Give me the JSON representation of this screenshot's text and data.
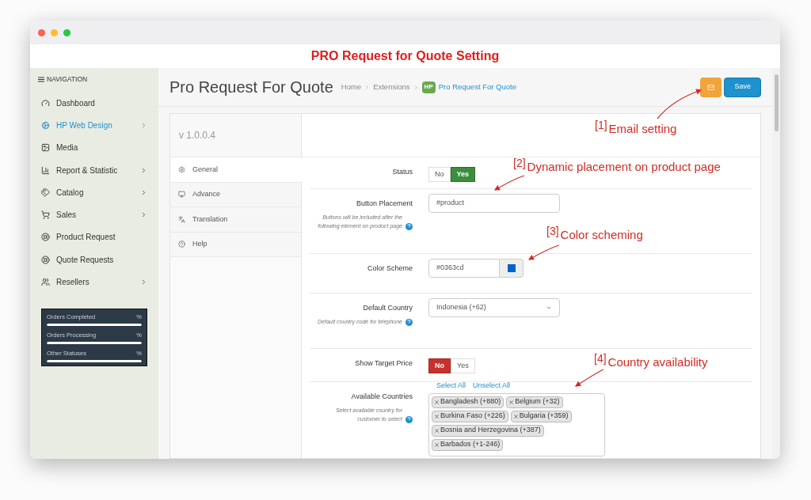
{
  "window": {
    "title": "PRO Request for Quote Setting"
  },
  "sidebar": {
    "heading": "NAVIGATION",
    "items": [
      {
        "label": "Dashboard",
        "selected": false,
        "submenu": false
      },
      {
        "label": "HP Web Design",
        "selected": true,
        "submenu": true
      },
      {
        "label": "Media",
        "selected": false,
        "submenu": false
      },
      {
        "label": "Report & Statistic",
        "selected": false,
        "submenu": true
      },
      {
        "label": "Catalog",
        "selected": false,
        "submenu": true
      },
      {
        "label": "Sales",
        "selected": false,
        "submenu": true
      },
      {
        "label": "Product Request",
        "selected": false,
        "submenu": false
      },
      {
        "label": "Quote Requests",
        "selected": false,
        "submenu": false
      },
      {
        "label": "Resellers",
        "selected": false,
        "submenu": true
      }
    ],
    "stats": [
      {
        "label": "Orders Completed",
        "reading": "%",
        "level": 1
      },
      {
        "label": "Orders Processing",
        "reading": "%",
        "level": 1
      },
      {
        "label": "Other Statuses",
        "reading": "%",
        "level": 1
      }
    ]
  },
  "page": {
    "title": "Pro Request For Quote",
    "breadcrumb": [
      {
        "label": "Home",
        "kind": "link"
      },
      {
        "label": "Extensions",
        "kind": "link"
      },
      {
        "label": "Pro Request For Quote",
        "kind": "current",
        "badge": "HP"
      }
    ],
    "buttons": [
      {
        "kind": "email"
      },
      {
        "kind": "save",
        "label": "Save"
      }
    ]
  },
  "version": "v 1.0.0.4",
  "tabs": [
    {
      "label": "General",
      "selected": true
    },
    {
      "label": "Advance",
      "selected": false
    },
    {
      "label": "Translation",
      "selected": false
    },
    {
      "label": "Help",
      "selected": false
    }
  ],
  "fields": [
    {
      "kind": "toggle",
      "label": "Status",
      "options": [
        {
          "label": "No",
          "selected": false
        },
        {
          "label": "Yes",
          "selected": true
        }
      ]
    },
    {
      "kind": "text",
      "label": "Button Placement",
      "help": "Buttons will be included after the following element on product page",
      "value": "#product"
    },
    {
      "kind": "color",
      "label": "Color Scheme",
      "value": "#0363cd",
      "color": "#0363cd"
    },
    {
      "kind": "select",
      "label": "Default Country",
      "help": "Default country code for telephone",
      "value": "Indonesia (+62)"
    },
    {
      "kind": "toggle",
      "label": "Show Target Price",
      "options": [
        {
          "label": "No",
          "selected": true
        },
        {
          "label": "Yes",
          "selected": false
        }
      ]
    },
    {
      "kind": "tags",
      "label": "Available Countries",
      "help": "Select available country for customer to select",
      "links": [
        "Select All",
        "Unselect All"
      ],
      "tags": [
        "Bangladesh (+880)",
        "Belgium (+32)",
        "Burkina Faso (+226)",
        "Bulgaria (+359)",
        "Bosnia and Herzegovina (+387)",
        "Barbados (+1-246)"
      ]
    }
  ],
  "annotations": [
    {
      "number": "[1]",
      "text": "Email setting"
    },
    {
      "number": "[2]",
      "text": "Dynamic placement on product page"
    },
    {
      "number": "[3]",
      "text": "Color scheming"
    },
    {
      "number": "[4]",
      "text": "Country availability"
    }
  ]
}
